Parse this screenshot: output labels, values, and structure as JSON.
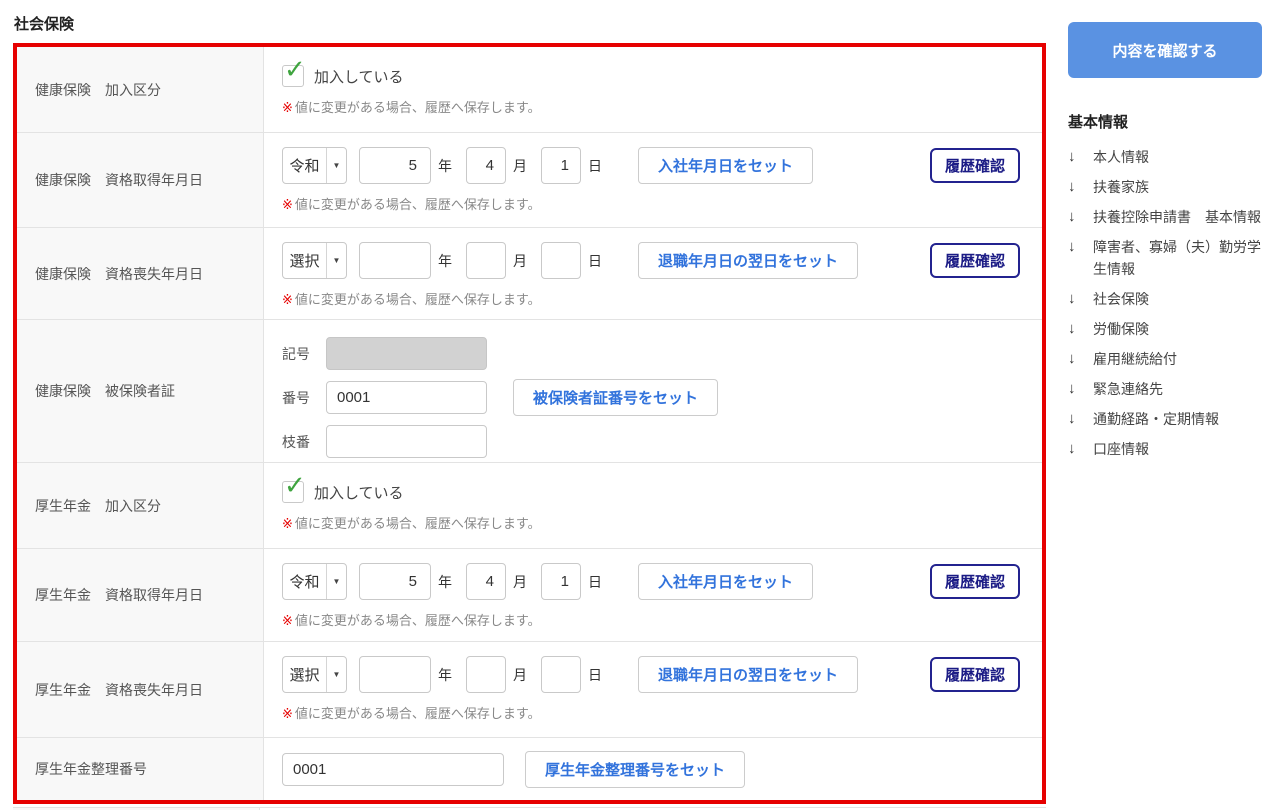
{
  "page": {
    "title": "社会保険"
  },
  "labels": {
    "year": "年",
    "month": "月",
    "day": "日",
    "note_mark": "※",
    "note_text": "値に変更がある場合、履歴へ保存します。"
  },
  "form": {
    "rows": [
      {
        "label": "健康保険　加入区分",
        "type": "checkbox",
        "checked": true,
        "checkbox_label": "加入している",
        "check_icon": "✓"
      },
      {
        "label": "健康保険　資格取得年月日",
        "type": "date",
        "era": "令和",
        "year": "5",
        "month": "4",
        "day": "1",
        "set_button": "入社年月日をセット",
        "history_button": "履歴確認"
      },
      {
        "label": "健康保険　資格喪失年月日",
        "type": "date",
        "era": "選択",
        "year": "",
        "month": "",
        "day": "",
        "set_button": "退職年月日の翌日をセット",
        "history_button": "履歴確認"
      },
      {
        "label": "健康保険　被保険者証",
        "type": "card",
        "fields": [
          {
            "label": "記号",
            "value": "",
            "disabled": true
          },
          {
            "label": "番号",
            "value": "0001",
            "disabled": false
          },
          {
            "label": "枝番",
            "value": "",
            "disabled": false
          }
        ],
        "set_button": "被保険者証番号をセット"
      },
      {
        "label": "厚生年金　加入区分",
        "type": "checkbox",
        "checked": true,
        "checkbox_label": "加入している",
        "check_icon": "✓"
      },
      {
        "label": "厚生年金　資格取得年月日",
        "type": "date",
        "era": "令和",
        "year": "5",
        "month": "4",
        "day": "1",
        "set_button": "入社年月日をセット",
        "history_button": "履歴確認"
      },
      {
        "label": "厚生年金　資格喪失年月日",
        "type": "date",
        "era": "選択",
        "year": "",
        "month": "",
        "day": "",
        "set_button": "退職年月日の翌日をセット",
        "history_button": "履歴確認"
      },
      {
        "label": "厚生年金整理番号",
        "type": "text",
        "value": "0001",
        "set_button": "厚生年金整理番号をセット"
      }
    ],
    "era_arrow_icon": "▼"
  },
  "sidebar": {
    "confirm_button": "内容を確認する",
    "heading": "基本情報",
    "arrow_icon": "↓",
    "items": [
      "本人情報",
      "扶養家族",
      "扶養控除申請書　基本情報",
      "障害者、寡婦（夫）勤労学生情報",
      "社会保険",
      "労働保険",
      "雇用継続給付",
      "緊急連絡先",
      "通勤経路・定期情報",
      "口座情報"
    ]
  }
}
